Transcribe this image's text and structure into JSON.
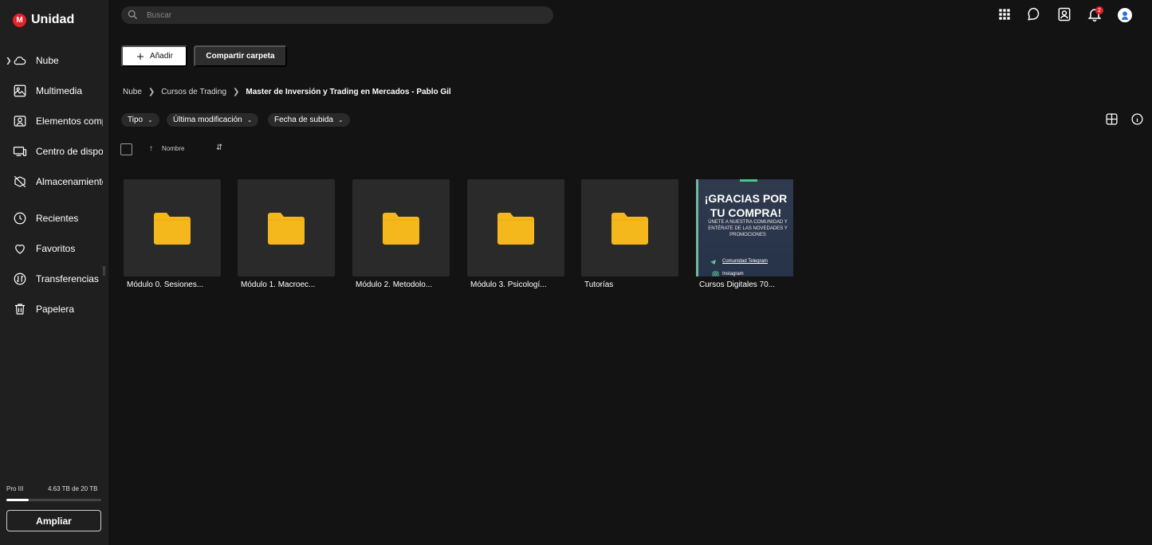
{
  "app": {
    "logo_letter": "M",
    "logo_text": "Unidad",
    "accent": "#e8202a"
  },
  "sidebar": {
    "items": [
      {
        "label": "Nube",
        "icon": "cloud-icon"
      },
      {
        "label": "Multimedia",
        "icon": "image-icon"
      },
      {
        "label": "Elementos compartidos",
        "icon": "shared-icon"
      },
      {
        "label": "Centro de dispositivos",
        "icon": "devices-icon"
      },
      {
        "label": "Almacenamiento",
        "icon": "storage-off-icon"
      },
      {
        "label": "Recientes",
        "icon": "clock-icon"
      },
      {
        "label": "Favoritos",
        "icon": "heart-icon"
      },
      {
        "label": "Transferencias",
        "icon": "transfer-icon"
      },
      {
        "label": "Papelera",
        "icon": "trash-icon"
      }
    ],
    "storage": {
      "plan": "Pro III",
      "used_text": "4.63 TB de 20 TB",
      "used_fraction": 0.2315
    },
    "upgrade_label": "Ampliar"
  },
  "search": {
    "placeholder": "Buscar",
    "value": ""
  },
  "header": {
    "notification_count": "2"
  },
  "toolbar": {
    "add_label": "Añadir",
    "share_label": "Compartir carpeta"
  },
  "breadcrumb": [
    "Nube",
    "Cursos de Trading",
    "Master de Inversión y Trading en Mercados - Pablo Gil"
  ],
  "filters": [
    {
      "label": "Tipo"
    },
    {
      "label": "Última modificación"
    },
    {
      "label": "Fecha de subida"
    }
  ],
  "sort": {
    "label": "Nombre"
  },
  "items": [
    {
      "name": "Módulo 0. Sesiones...",
      "type": "folder"
    },
    {
      "name": "Módulo 1. Macroec...",
      "type": "folder"
    },
    {
      "name": "Módulo 2. Metodolo...",
      "type": "folder"
    },
    {
      "name": "Módulo 3. Psicologí...",
      "type": "folder"
    },
    {
      "name": "Tutorías",
      "type": "folder"
    },
    {
      "name": "Cursos Digitales 70...",
      "type": "image"
    }
  ],
  "thumbnail": {
    "headline": "¡GRACIAS POR TU COMPRA!",
    "subline": "ÚNETE A NUESTRA COMUNIDAD Y ENTÉRATE DE LAS NOVEDADES Y PROMOCIONES",
    "link1": "Comunidad Telegram",
    "link2": "Instagram"
  },
  "colors": {
    "folder": "#f5b81c",
    "bg": "#131313",
    "sidebar_bg": "#1f1f1f"
  }
}
